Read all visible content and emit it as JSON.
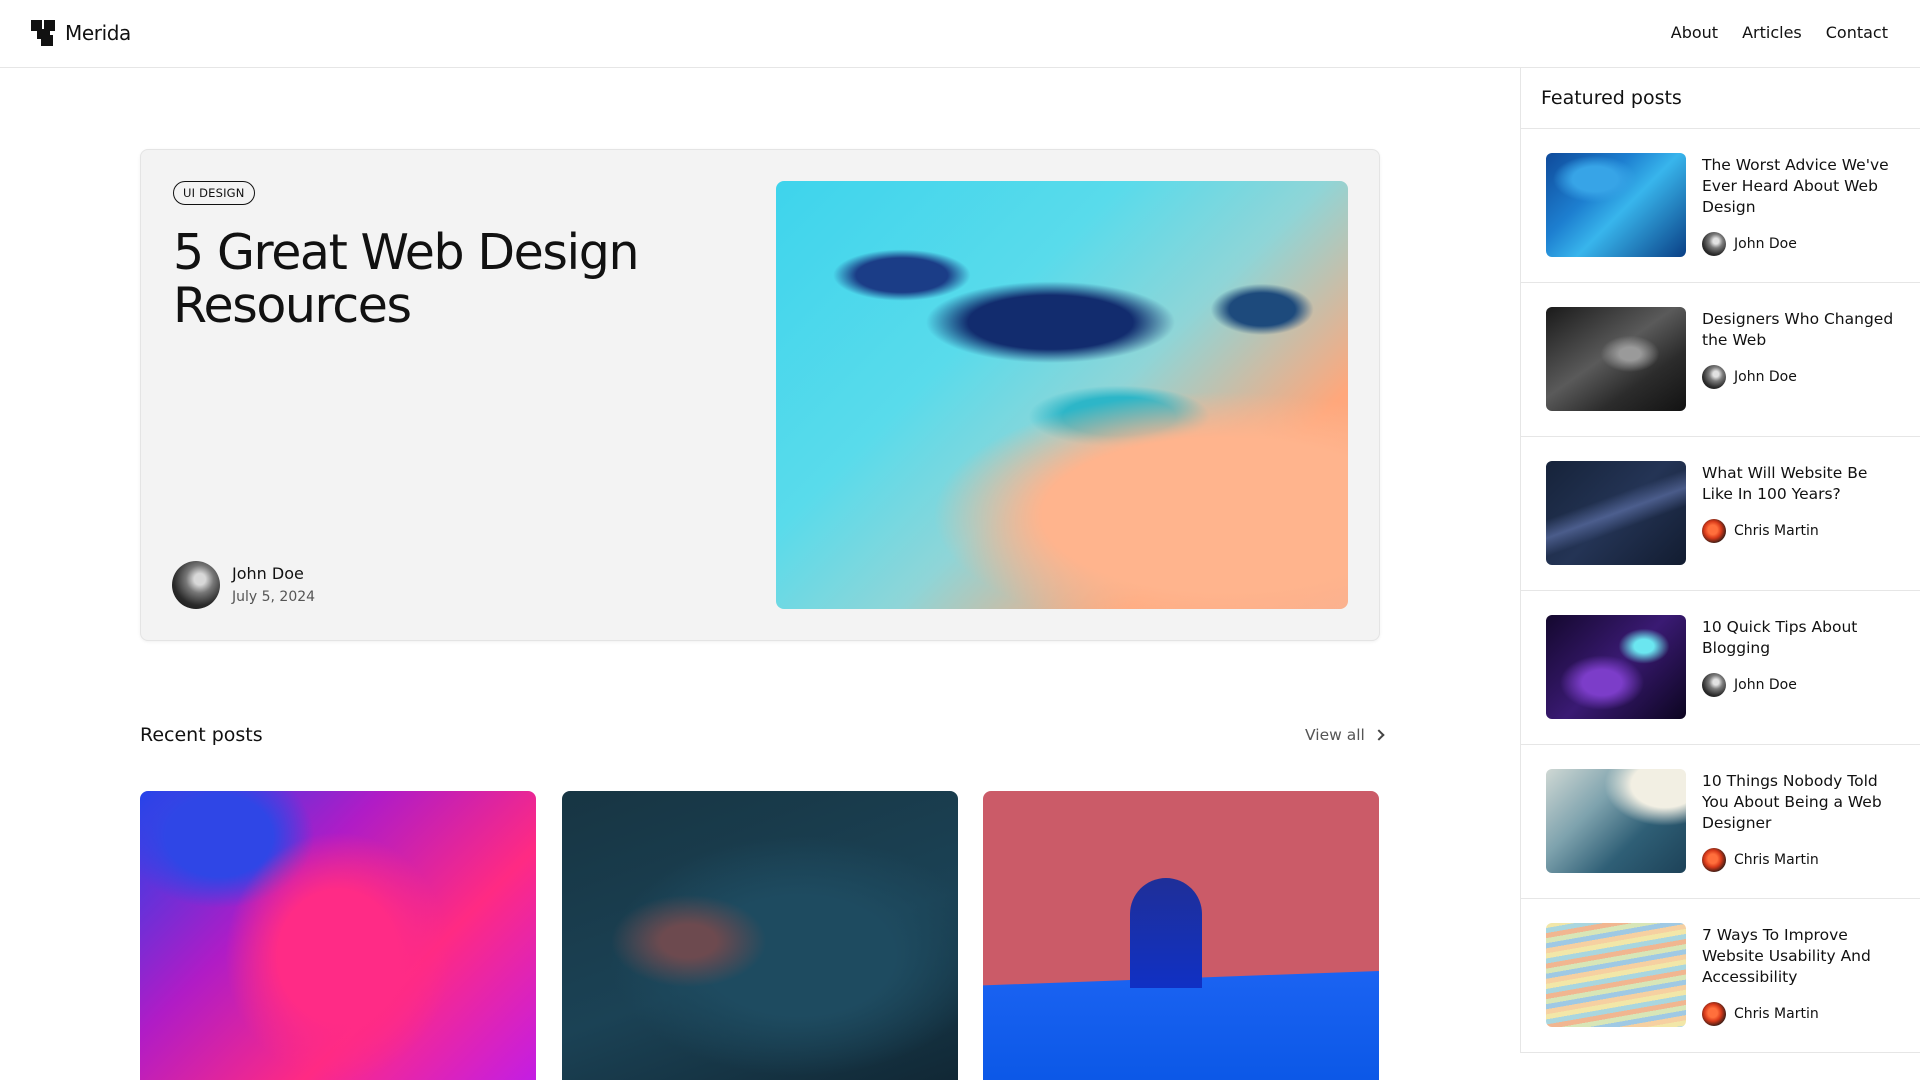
{
  "header": {
    "brand": "Merida",
    "nav": [
      "About",
      "Articles",
      "Contact"
    ]
  },
  "hero": {
    "tag": "UI DESIGN",
    "title": "5 Great Web Design Resources",
    "author": "John Doe",
    "date": "July 5, 2024",
    "image_icon": "abstract-painting-image"
  },
  "recent": {
    "title": "Recent posts",
    "view_all": "View all",
    "cards": [
      {
        "image": "abstract-pink-paint-image"
      },
      {
        "image": "space-dust-image"
      },
      {
        "image": "red-arch-scene-image"
      }
    ]
  },
  "featured": {
    "title": "Featured posts",
    "posts": [
      {
        "title": "The Worst Advice We've Ever Heard About Web Design",
        "author": "John Doe",
        "thumb": "blue-paint-image"
      },
      {
        "title": "Designers Who Changed the Web",
        "author": "John Doe",
        "thumb": "grunge-texture-image"
      },
      {
        "title": "What Will Website Be Like In 100 Years?",
        "author": "Chris Martin",
        "thumb": "milky-way-image"
      },
      {
        "title": "10 Quick Tips About Blogging",
        "author": "John Doe",
        "thumb": "purple-bubbles-image"
      },
      {
        "title": "10 Things Nobody Told You About Being a Web Designer",
        "author": "Chris Martin",
        "thumb": "abstract-wave-image"
      },
      {
        "title": "7 Ways To Improve Website Usability And Accessibility",
        "author": "Chris Martin",
        "thumb": "wavy-lines-image"
      }
    ]
  },
  "colors": {
    "text": "#111111",
    "muted": "#555555",
    "border": "#e6e6e6",
    "hero_bg": "#f3f3f3"
  }
}
